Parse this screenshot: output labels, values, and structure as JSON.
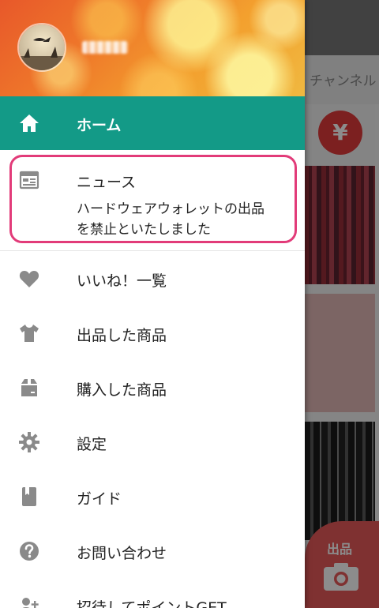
{
  "background": {
    "tab_text": "チャンネル",
    "badge": "¥",
    "fab_label": "出品"
  },
  "drawer": {
    "user_name": "hidden",
    "home": {
      "label": "ホーム",
      "icon": "home-icon"
    },
    "news": {
      "label": "ニュース",
      "icon": "newspaper-icon",
      "headline_line1": "ハードウェアウォレットの出品",
      "headline_line2": "を禁止といたしました"
    },
    "items": [
      {
        "label": "いいね！一覧",
        "icon": "heart-icon"
      },
      {
        "label": "出品した商品",
        "icon": "tshirt-icon"
      },
      {
        "label": "購入した商品",
        "icon": "box-icon"
      },
      {
        "label": "設定",
        "icon": "gear-icon"
      },
      {
        "label": "ガイド",
        "icon": "book-icon"
      },
      {
        "label": "お問い合わせ",
        "icon": "help-icon"
      },
      {
        "label": "招待してポイントGET",
        "icon": "invite-icon"
      }
    ]
  },
  "colors": {
    "accent": "#139a87",
    "highlight": "#e23b79",
    "icon_gray": "#8a8a8a"
  }
}
